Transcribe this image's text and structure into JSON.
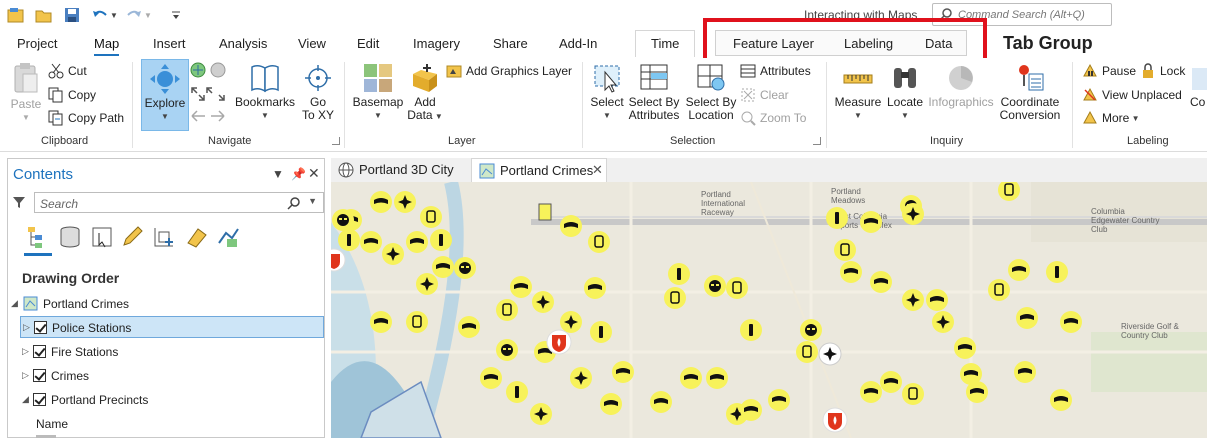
{
  "qat": {
    "interacting": "Interacting with Maps",
    "command_search_placeholder": "Command Search (Alt+Q)"
  },
  "tabs": [
    {
      "label": "Project"
    },
    {
      "label": "Map",
      "active": true
    },
    {
      "label": "Insert"
    },
    {
      "label": "Analysis"
    },
    {
      "label": "View"
    },
    {
      "label": "Edit"
    },
    {
      "label": "Imagery"
    },
    {
      "label": "Share"
    },
    {
      "label": "Add-In"
    },
    {
      "label": "Time"
    }
  ],
  "tab_group": {
    "tabs": [
      "Feature Layer",
      "Labeling",
      "Data"
    ],
    "annotation": "Tab Group",
    "highlight_color": "#e0111c"
  },
  "ribbon": {
    "clipboard": {
      "label": "Clipboard",
      "paste": "Paste",
      "cut": "Cut",
      "copy": "Copy",
      "copy_path": "Copy Path"
    },
    "navigate": {
      "label": "Navigate",
      "explore": "Explore",
      "bookmarks": "Bookmarks",
      "go_to_xy_1": "Go",
      "go_to_xy_2": "To XY"
    },
    "layer": {
      "label": "Layer",
      "basemap": "Basemap",
      "add_data_1": "Add",
      "add_data_2": "Data",
      "add_graphics_layer": "Add Graphics Layer"
    },
    "selection": {
      "label": "Selection",
      "select": "Select",
      "select_by_attributes_1": "Select By",
      "select_by_attributes_2": "Attributes",
      "select_by_location_1": "Select By",
      "select_by_location_2": "Location",
      "attributes": "Attributes",
      "clear": "Clear",
      "zoom_to": "Zoom To"
    },
    "inquiry": {
      "label": "Inquiry",
      "measure": "Measure",
      "locate": "Locate",
      "infographics": "Infographics",
      "coordinate_conversion_1": "Coordinate",
      "coordinate_conversion_2": "Conversion"
    },
    "labeling": {
      "label": "Labeling",
      "pause": "Pause",
      "lock": "Lock",
      "view_unplaced": "View Unplaced",
      "more": "More",
      "co": "Co"
    }
  },
  "contents": {
    "title": "Contents",
    "search_placeholder": "Search",
    "drawing_order": "Drawing Order",
    "map_name": "Portland Crimes",
    "layers": [
      {
        "label": "Police Stations",
        "checked": true,
        "selected": true
      },
      {
        "label": "Fire Stations",
        "checked": true
      },
      {
        "label": "Crimes",
        "checked": true
      },
      {
        "label": "Portland Precincts",
        "checked": true,
        "expanded": true
      }
    ],
    "field_name": "Name"
  },
  "doc_tabs": [
    {
      "label": "Portland 3D City"
    },
    {
      "label": "Portland Crimes",
      "active": true
    }
  ],
  "map": {
    "labels": [
      "Portland International Raceway",
      "Portland Meadows",
      "East Columbia Sports Complex",
      "Columbia Edgewater Country Club",
      "Riverside Golf & Country Club"
    ],
    "symbol_color": "#f7f25a",
    "fire_station_color": "#e0351c"
  },
  "colors": {
    "accent": "#1e73be",
    "selected_row": "#cde5f7"
  }
}
